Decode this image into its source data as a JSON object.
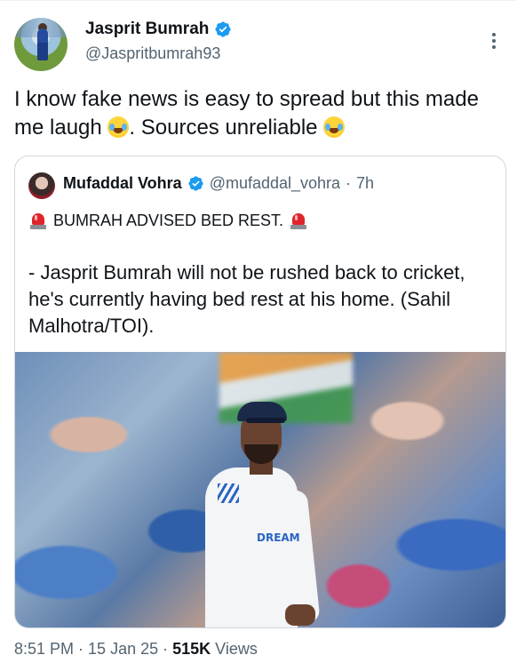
{
  "author": {
    "display_name": "Jasprit Bumrah",
    "handle": "@Jaspritbumrah93",
    "verified_icon": "verified-badge-icon",
    "verified_color": "#1d9bf0"
  },
  "tweet": {
    "text_part1": "I know fake news is easy to spread but this made me laugh ",
    "text_part2": ".  Sources unreliable ",
    "emoji_icon": "face-with-tears-of-joy-icon"
  },
  "quoted": {
    "display_name": "Mufaddal Vohra",
    "handle": "@mufaddal_vohra",
    "separator": "·",
    "time": "7h",
    "headline": "BUMRAH ADVISED BED REST.",
    "headline_icon": "police-light-icon",
    "body": "- Jasprit Bumrah will not be rushed back to cricket, he's currently having bed rest at his home. (Sahil Malhotra/TOI).",
    "photo_jersey_text": "DREAM"
  },
  "meta": {
    "time": "8:51 PM",
    "sep1": " · ",
    "date": "15 Jan 25",
    "sep2": " · ",
    "views_count": "515K",
    "views_label": " Views"
  }
}
